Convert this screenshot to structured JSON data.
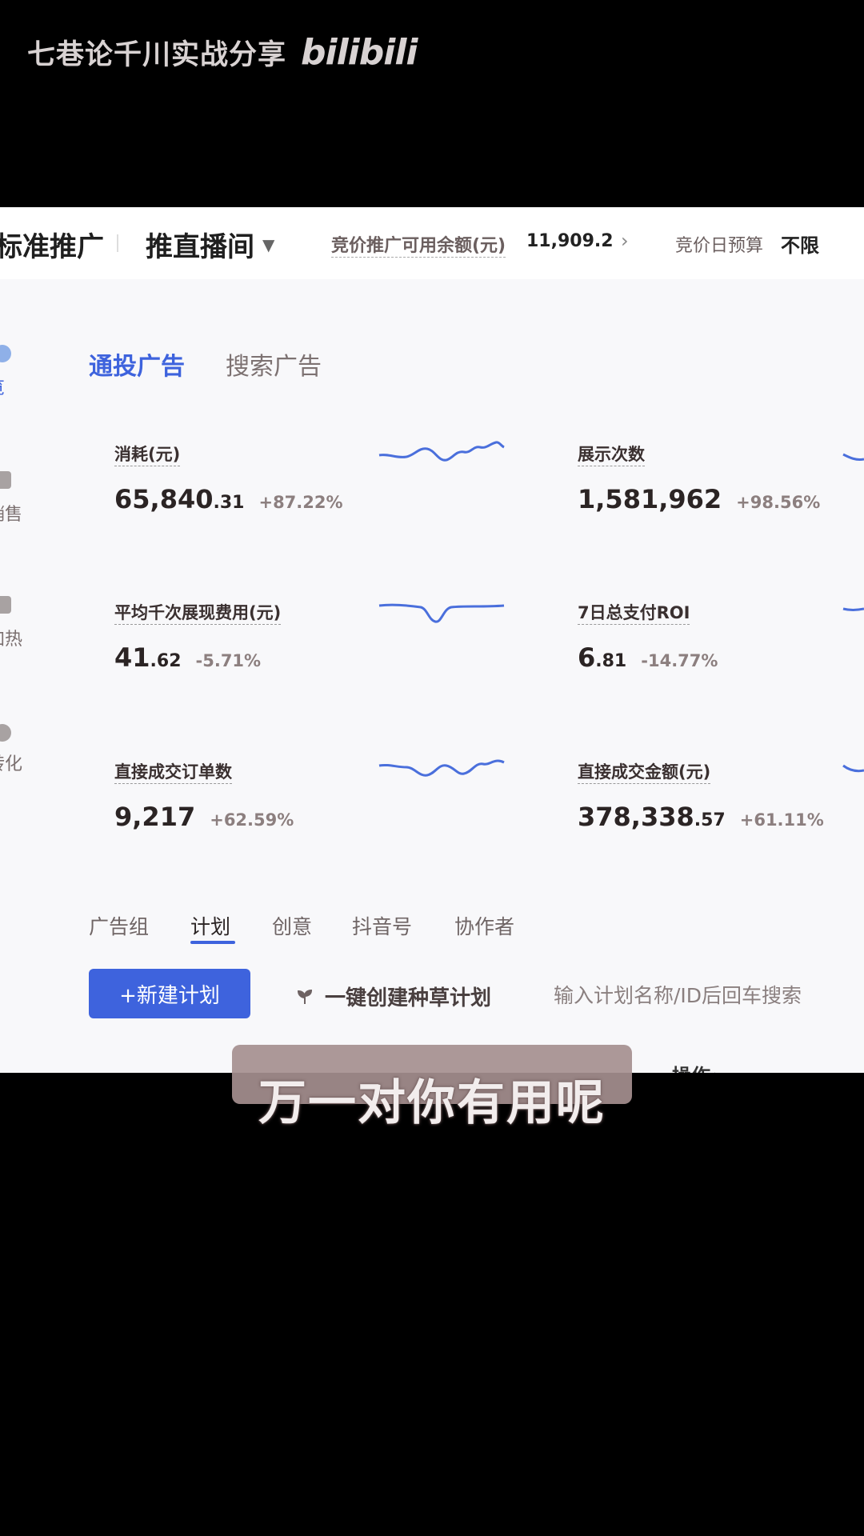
{
  "watermark": {
    "channel": "七巷论千川实战分享",
    "logo": "bilibili"
  },
  "topbar": {
    "brand": "标准推广",
    "account": "推直播间",
    "balance_label": "竞价推广可用余额(元)",
    "balance_value": "11,909.2",
    "budget_label": "竞价日预算",
    "budget_value": "不限"
  },
  "sidebar": {
    "items": [
      {
        "label": "览",
        "icon": "overview-icon"
      },
      {
        "label": "销售",
        "icon": "sales-icon"
      },
      {
        "label": "加热",
        "icon": "boost-icon"
      },
      {
        "label": "转化",
        "icon": "conversion-icon"
      }
    ]
  },
  "tabs": [
    {
      "label": "通投广告",
      "active": true
    },
    {
      "label": "搜索广告",
      "active": false
    }
  ],
  "metrics": [
    {
      "label": "消耗(元)",
      "int": "65,840",
      "dec": ".31",
      "delta": "+87.22%"
    },
    {
      "label": "展示次数",
      "int": "1,581,962",
      "dec": "",
      "delta": "+98.56%"
    },
    {
      "label": "平均千次展现费用(元)",
      "int": "41",
      "dec": ".62",
      "delta": "-5.71%"
    },
    {
      "label": "7日总支付ROI",
      "int": "6",
      "dec": ".81",
      "delta": "-14.77%"
    },
    {
      "label": "直接成交订单数",
      "int": "9,217",
      "dec": "",
      "delta": "+62.59%"
    },
    {
      "label": "直接成交金额(元)",
      "int": "378,338",
      "dec": ".57",
      "delta": "+61.11%"
    }
  ],
  "subtabs": [
    {
      "label": "广告组",
      "active": false
    },
    {
      "label": "计划",
      "active": true
    },
    {
      "label": "创意",
      "active": false
    },
    {
      "label": "抖音号",
      "active": false
    },
    {
      "label": "协作者",
      "active": false
    }
  ],
  "actions": {
    "new_plan": "+新建计划",
    "grass_plan": "一键创建种草计划",
    "search_placeholder": "输入计划名称/ID后回车搜索"
  },
  "table": {
    "col_operation": "操作"
  },
  "subtitle": "万一对你有用呢",
  "colors": {
    "accent": "#3e63dd",
    "sparkline": "#4a6fdc"
  }
}
